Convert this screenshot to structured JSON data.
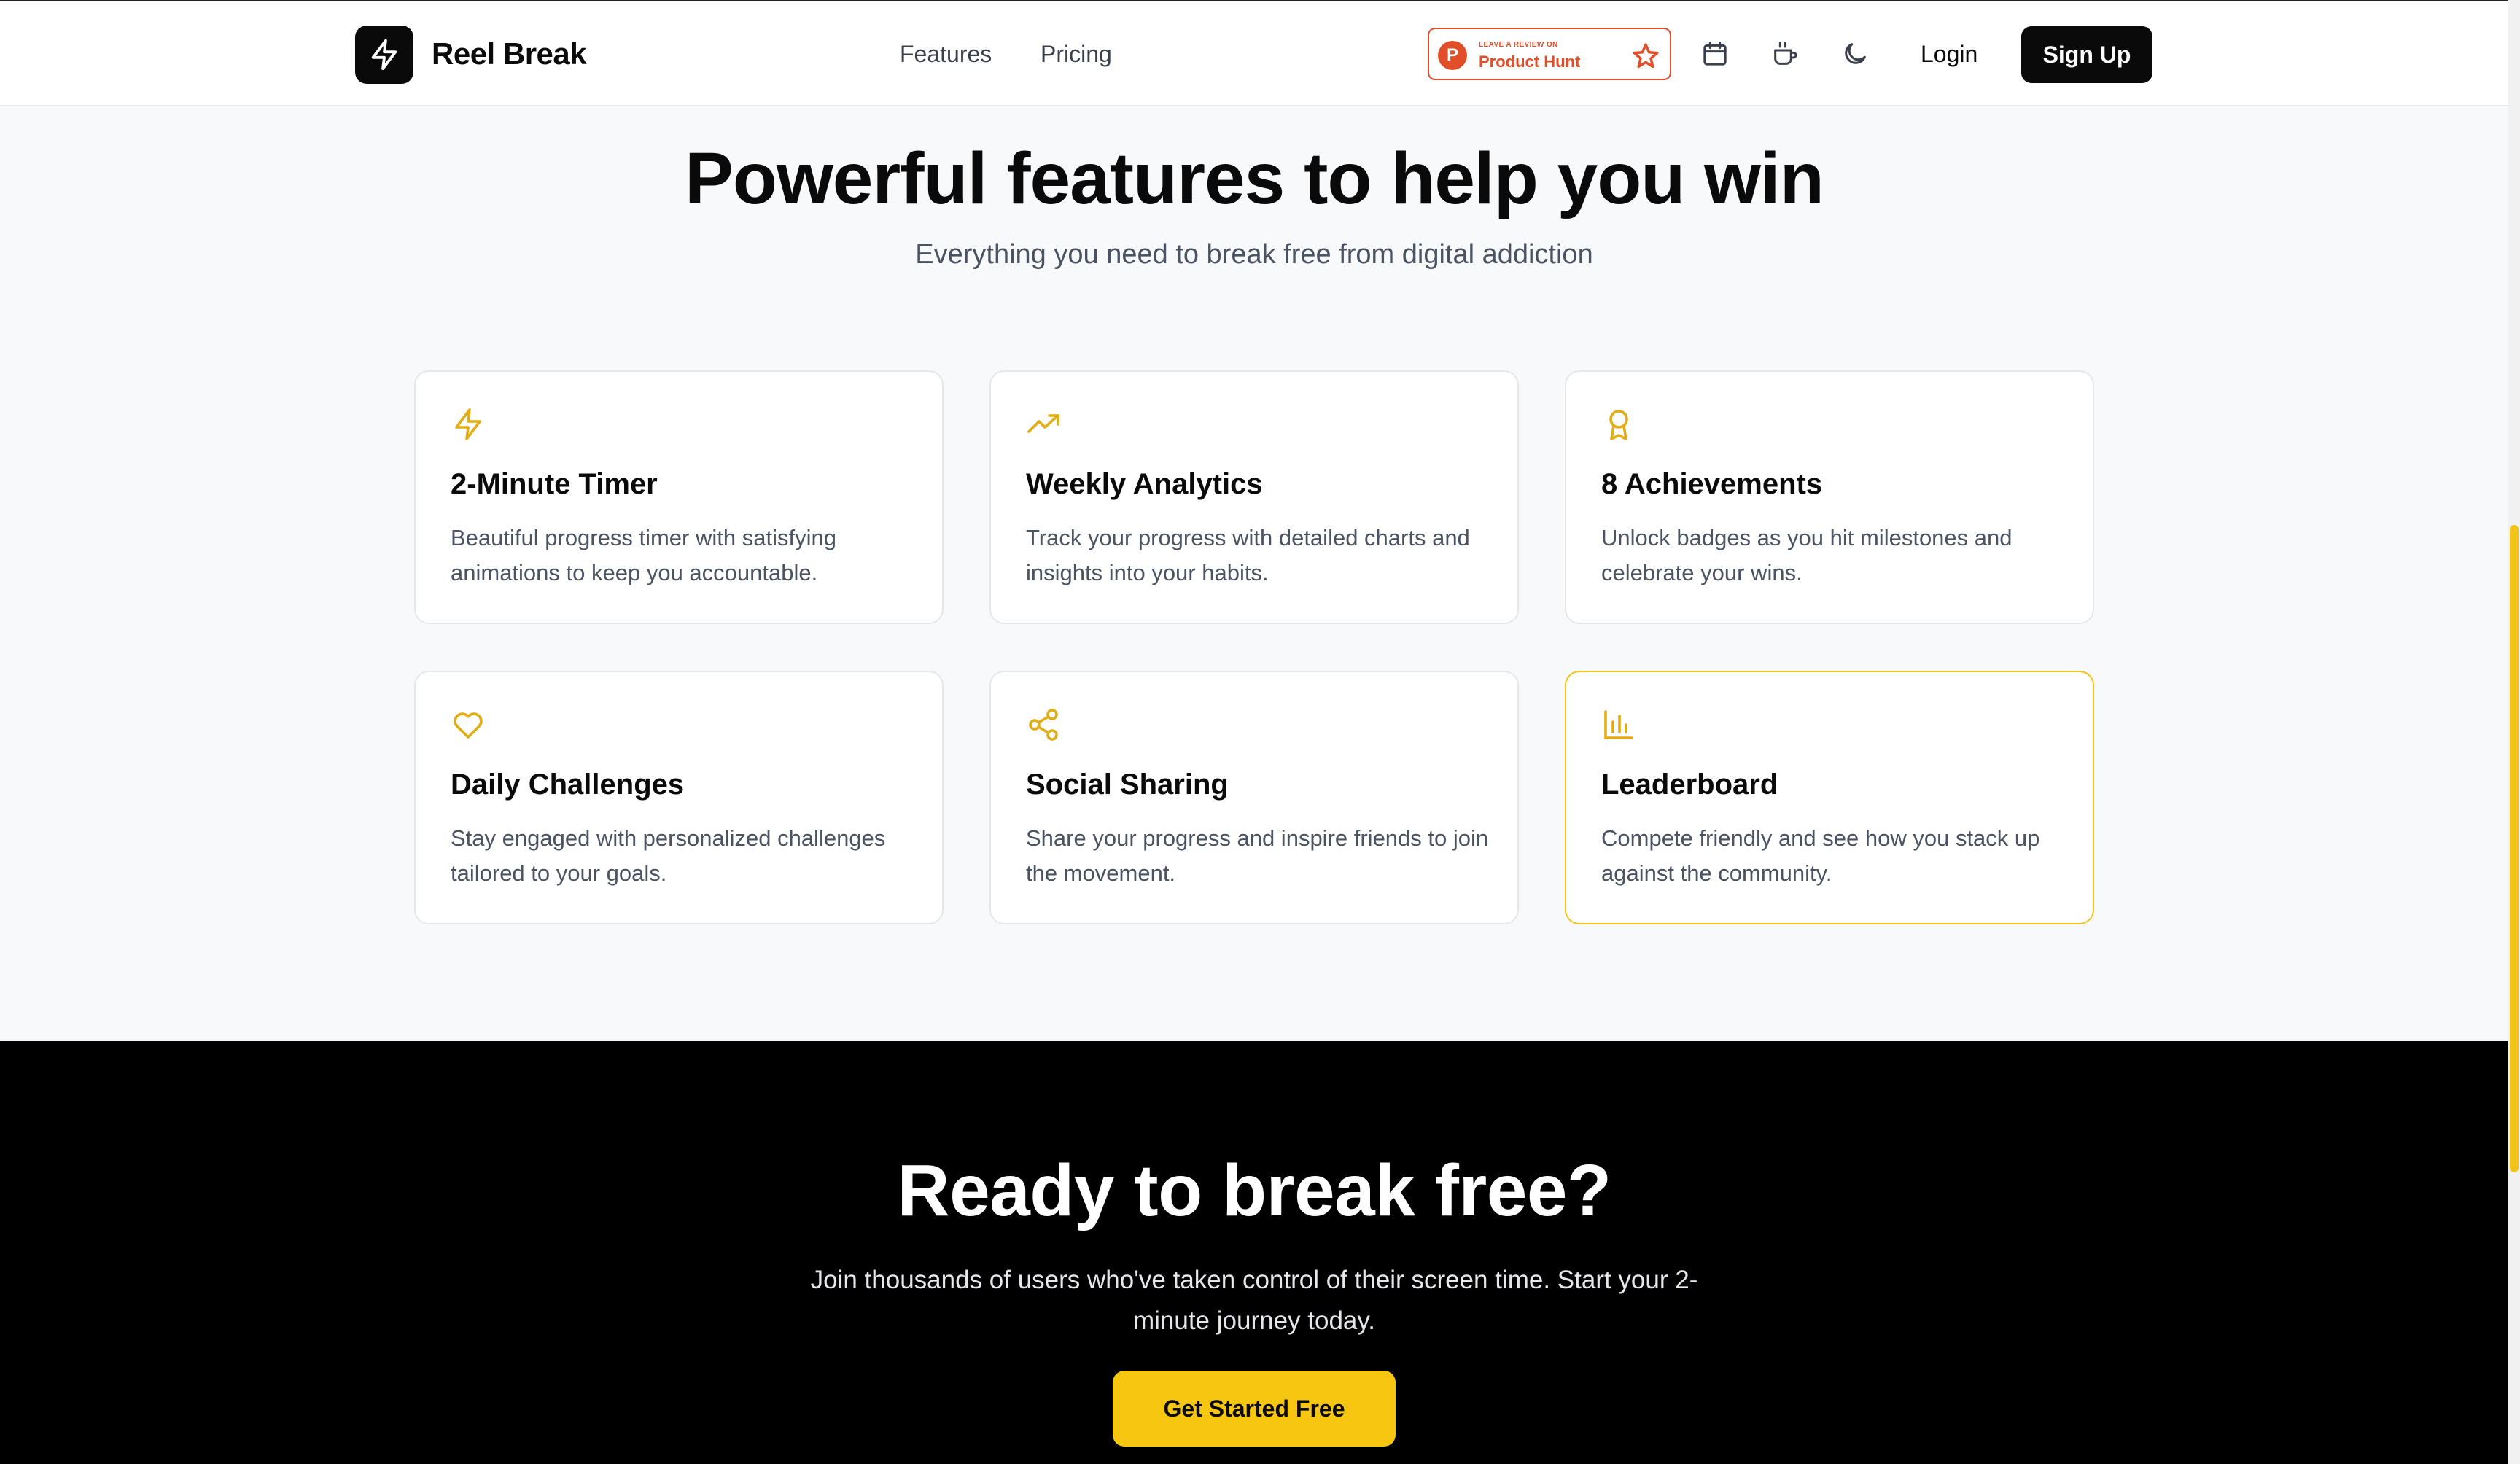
{
  "header": {
    "brand": "Reel Break",
    "nav": [
      {
        "label": "Features"
      },
      {
        "label": "Pricing"
      }
    ],
    "product_hunt": {
      "small": "LEAVE A REVIEW ON",
      "big": "Product Hunt",
      "letter": "P"
    },
    "login_label": "Login",
    "signup_label": "Sign Up"
  },
  "features": {
    "title": "Powerful features to help you win",
    "subtitle": "Everything you need to break free from digital addiction",
    "cards": [
      {
        "icon": "lightning-icon",
        "title": "2-Minute Timer",
        "desc": "Beautiful progress timer with satisfying animations to keep you accountable."
      },
      {
        "icon": "trending-up-icon",
        "title": "Weekly Analytics",
        "desc": "Track your progress with detailed charts and insights into your habits."
      },
      {
        "icon": "award-icon",
        "title": "8 Achievements",
        "desc": "Unlock badges as you hit milestones and celebrate your wins."
      },
      {
        "icon": "heart-icon",
        "title": "Daily Challenges",
        "desc": "Stay engaged with personalized challenges tailored to your goals."
      },
      {
        "icon": "share-icon",
        "title": "Social Sharing",
        "desc": "Share your progress and inspire friends to join the movement."
      },
      {
        "icon": "bar-chart-icon",
        "title": "Leaderboard",
        "desc": "Compete friendly and see how you stack up against the community."
      }
    ]
  },
  "cta": {
    "title": "Ready to break free?",
    "subtitle": "Join thousands of users who've taken control of their screen time. Start your 2-minute journey today.",
    "button_label": "Get Started Free"
  },
  "colors": {
    "accent": "#f6c611",
    "icon": "#e2ad14",
    "product_hunt": "#e04f2a",
    "dark": "#0a0a0a"
  }
}
